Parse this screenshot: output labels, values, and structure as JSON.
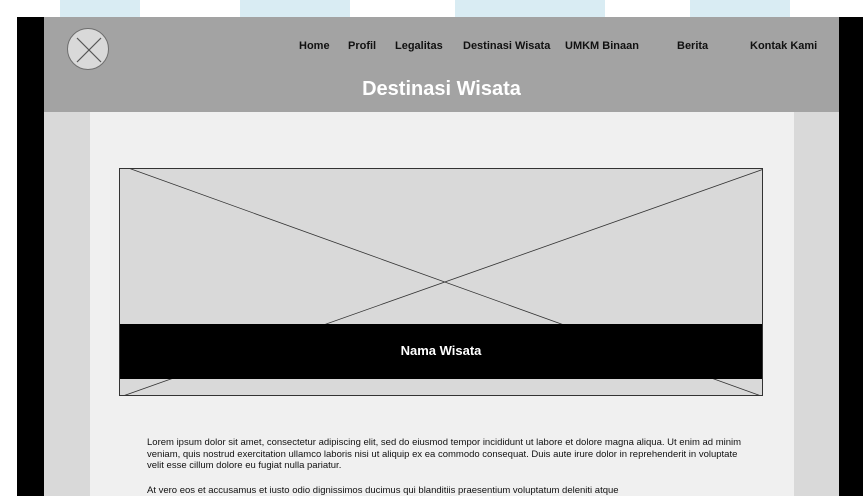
{
  "nav": {
    "items": [
      "Home",
      "Profil",
      "Legalitas",
      "Destinasi Wisata",
      "UMKM Binaan",
      "Berita",
      "Kontak Kami"
    ]
  },
  "page": {
    "title": "Destinasi Wisata"
  },
  "hero": {
    "name": "Nama Wisata"
  },
  "content": {
    "paragraph_1": "Lorem ipsum dolor sit amet, consectetur adipiscing elit, sed do eiusmod tempor incididunt ut labore et dolore magna aliqua. Ut enim ad minim veniam, quis nostrud exercitation ullamco laboris nisi ut aliquip ex ea commodo consequat. Duis aute irure dolor in reprehenderit in voluptate velit esse cillum dolore eu fugiat nulla pariatur.",
    "paragraph_2": "At vero eos et accusamus et iusto odio dignissimos ducimus qui blanditiis praesentium voluptatum deleniti atque"
  },
  "colors": {
    "header": "#a3a3a3",
    "content_bg": "#f0f0f0",
    "side_panels": "#d9d9d9",
    "frame": "#000000",
    "hero_band": "#000000"
  },
  "icons": {
    "logo": "image-placeholder-icon",
    "hero_image": "image-placeholder-icon"
  }
}
